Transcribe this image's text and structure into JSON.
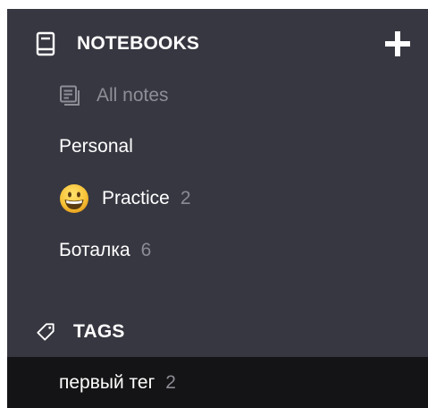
{
  "notebooks": {
    "header": "NOTEBOOKS",
    "all_notes_label": "All notes",
    "items": [
      {
        "label": "Personal"
      },
      {
        "label": "Practice",
        "count": "2",
        "icon": "grinning-face-emoji"
      },
      {
        "label": "Боталка",
        "count": "6"
      }
    ]
  },
  "tags": {
    "header": "TAGS",
    "items": [
      {
        "label": "первый тег",
        "count": "2",
        "selected": true
      }
    ]
  },
  "colors": {
    "sidebar_bg": "#373741",
    "selected_bg": "#141416",
    "muted_text": "#8b8b94",
    "text": "#ffffff"
  }
}
